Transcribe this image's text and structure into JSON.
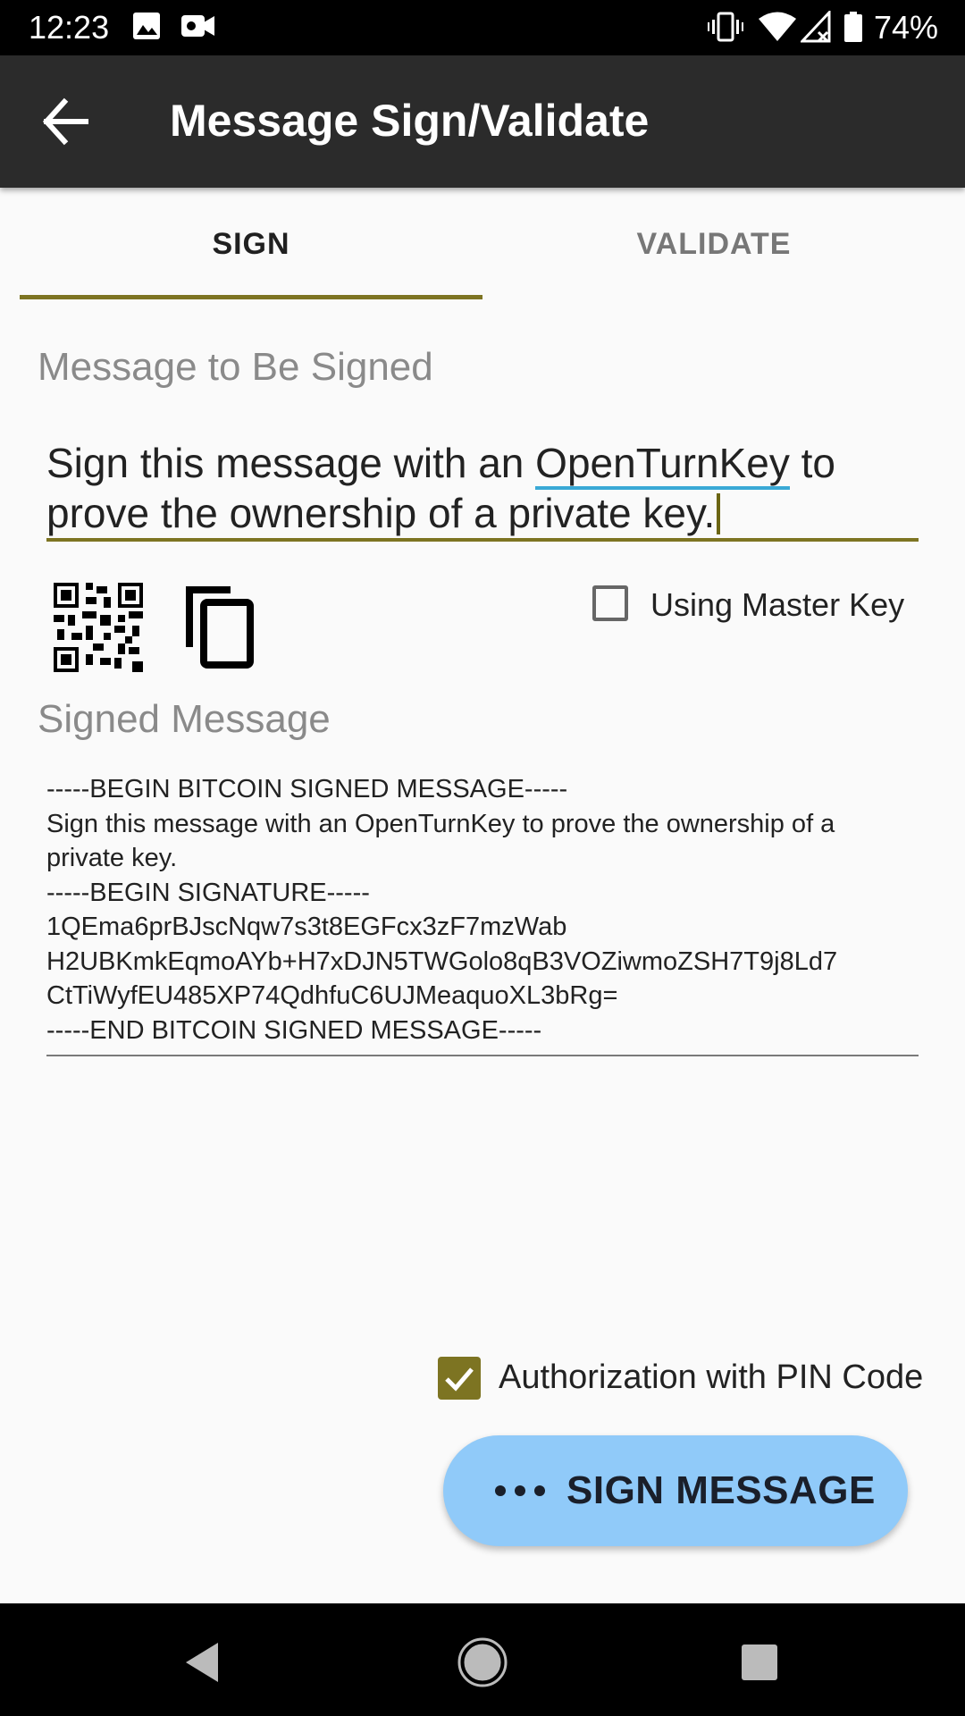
{
  "status_bar": {
    "time": "12:23",
    "battery": "74%",
    "icons": [
      "image-icon",
      "video-camera-icon",
      "vibrate-icon",
      "wifi-icon",
      "signal-icon",
      "battery-icon"
    ]
  },
  "app_bar": {
    "title": "Message Sign/Validate",
    "back_icon": "arrow-back-icon"
  },
  "tabs": [
    {
      "label": "SIGN",
      "selected": true
    },
    {
      "label": "VALIDATE",
      "selected": false
    }
  ],
  "message_field": {
    "label": "Message to Be Signed",
    "value_before": "Sign this message with an ",
    "value_underlined": "OpenTurnKey",
    "value_after_line1": " to",
    "value_line2": "prove the ownership of a private key."
  },
  "actions": {
    "qr_icon": "qr-code-icon",
    "copy_icon": "copy-icon"
  },
  "master_key": {
    "label": "Using Master Key",
    "checked": false
  },
  "signed_message": {
    "label": "Signed Message",
    "lines": [
      "-----BEGIN BITCOIN SIGNED MESSAGE-----",
      "Sign this message with an OpenTurnKey to prove the ownership of a",
      "private key.",
      "-----BEGIN SIGNATURE-----",
      "1QEma6prBJscNqw7s3t8EGFcx3zF7mzWab",
      "H2UBKmkEqmoAYb+H7xDJN5TWGolo8qB3VOZiwmoZSH7T9j8Ld7",
      "CtTiWyfEU485XP74QdhfuC6UJMeaquoXL3bRg=",
      "-----END BITCOIN SIGNED MESSAGE-----"
    ]
  },
  "pin_auth": {
    "label": "Authorization with PIN Code",
    "checked": true
  },
  "sign_button": {
    "label": "SIGN MESSAGE",
    "icon": "more-dots-icon"
  },
  "colors": {
    "accent": "#7d7422",
    "button": "#90caf9",
    "app_bar": "#2b2b2b"
  },
  "nav_bar": {
    "icons": [
      "nav-back-icon",
      "nav-home-icon",
      "nav-recents-icon"
    ]
  }
}
